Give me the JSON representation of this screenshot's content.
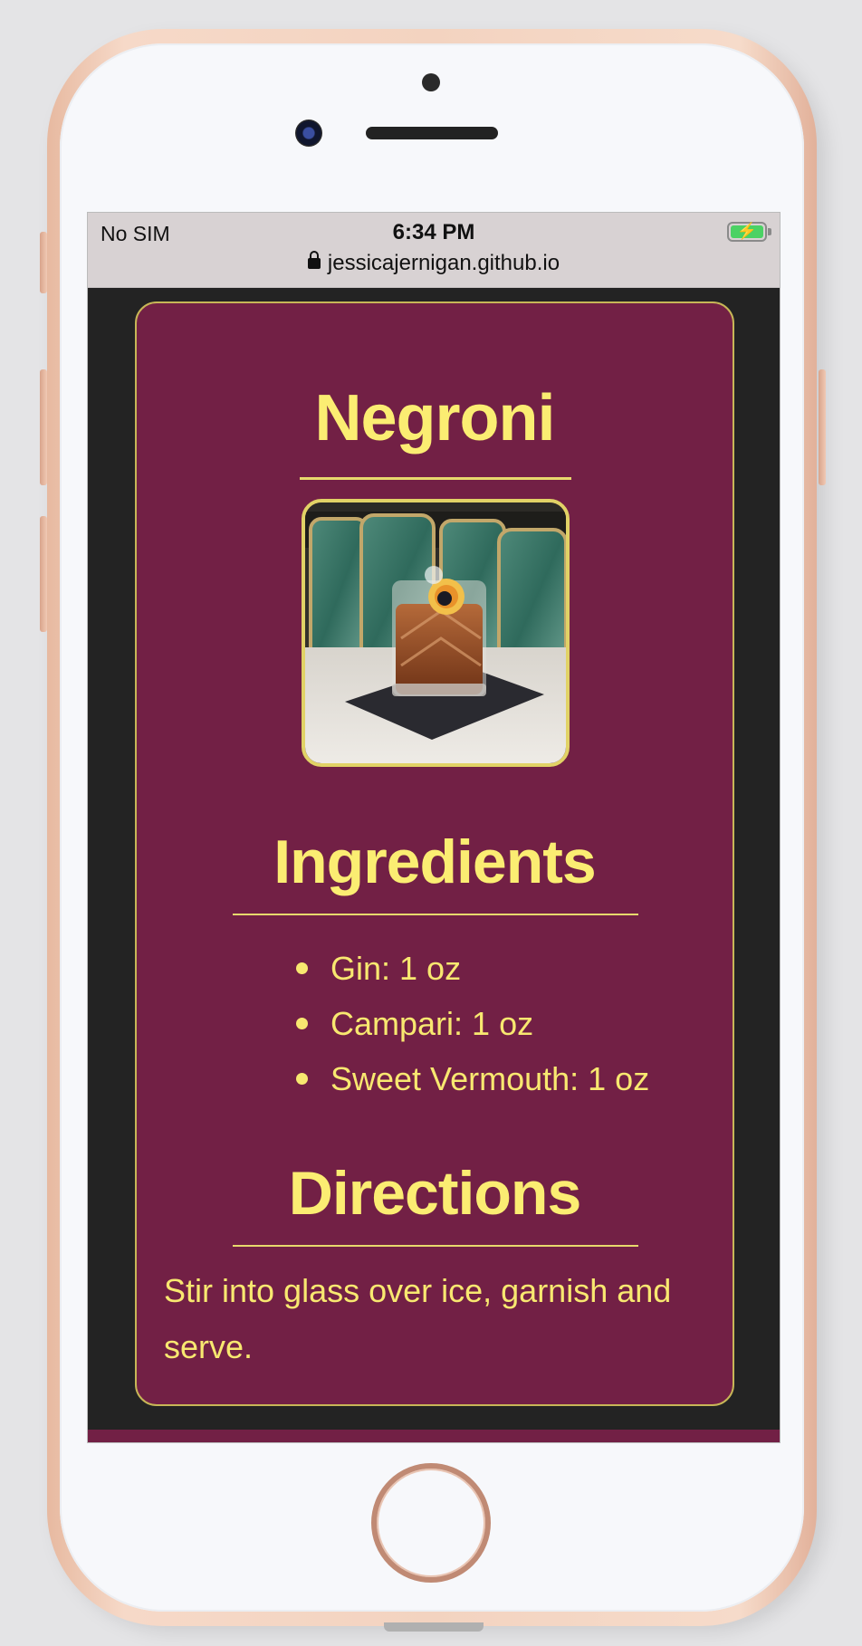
{
  "status_bar": {
    "carrier": "No SIM",
    "time": "6:34 PM",
    "url": "jessicajernigan.github.io",
    "battery_charging": true
  },
  "recipe": {
    "title": "Negroni",
    "ingredients_heading": "Ingredients",
    "ingredients": [
      "Gin: 1 oz",
      "Campari: 1 oz",
      "Sweet Vermouth: 1 oz"
    ],
    "directions_heading": "Directions",
    "directions": "Stir into glass over ice, garnish and serve."
  },
  "colors": {
    "card_background": "#722045",
    "accent_yellow": "#fbed72",
    "page_background": "#232323"
  }
}
